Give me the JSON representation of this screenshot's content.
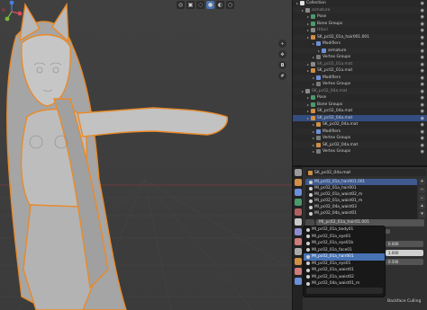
{
  "outliner": {
    "rows": [
      {
        "label": "Collection",
        "icon": "collection-icon",
        "depth": 0,
        "dim": false,
        "color": "#e0e0e0"
      },
      {
        "label": "armature",
        "icon": "armature-icon",
        "depth": 1,
        "dim": true,
        "color": "#8a8a8a"
      },
      {
        "label": "Pose",
        "icon": "pose-icon",
        "depth": 2,
        "dim": false,
        "color": "#4b9a6c"
      },
      {
        "label": "Bone Groups",
        "icon": "bone-group-icon",
        "depth": 2,
        "dim": false,
        "color": "#4b9a6c"
      },
      {
        "label": "Hitori",
        "icon": "armature-icon",
        "depth": 2,
        "dim": true,
        "color": "#8a8a8a"
      },
      {
        "label": "SK_pc02_01a_hair001.001",
        "icon": "mesh-icon",
        "depth": 2,
        "dim": false,
        "color": "#d08f45"
      },
      {
        "label": "Modifiers",
        "icon": "wrench-icon",
        "depth": 3,
        "dim": false,
        "color": "#6c8fd9"
      },
      {
        "label": "armature",
        "icon": "modifier-icon",
        "depth": 4,
        "dim": false,
        "color": "#6c8fd9"
      },
      {
        "label": "Vertex Groups",
        "icon": "vertex-group-icon",
        "depth": 3,
        "dim": false,
        "color": "#7a7a7a"
      },
      {
        "label": "SK_pc02_01a.mat",
        "icon": "mesh-icon",
        "depth": 2,
        "dim": true,
        "color": "#8a8a8a"
      },
      {
        "label": "SK_pc02_01a.mat",
        "icon": "mesh-icon",
        "depth": 2,
        "dim": false,
        "color": "#d08f45"
      },
      {
        "label": "Modifiers",
        "icon": "wrench-icon",
        "depth": 3,
        "dim": false,
        "color": "#6c8fd9"
      },
      {
        "label": "Vertex Groups",
        "icon": "vertex-group-icon",
        "depth": 3,
        "dim": false,
        "color": "#7a7a7a"
      },
      {
        "label": "SK_pc02_04a.mat",
        "icon": "armature-icon",
        "depth": 1,
        "dim": true,
        "color": "#8a8a8a"
      },
      {
        "label": "Pose",
        "icon": "pose-icon",
        "depth": 2,
        "dim": false,
        "color": "#4b9a6c"
      },
      {
        "label": "Bone Groups",
        "icon": "bone-group-icon",
        "depth": 2,
        "dim": false,
        "color": "#4b9a6c"
      },
      {
        "label": "SK_pc02_04a.mat",
        "icon": "mesh-icon",
        "depth": 2,
        "dim": false,
        "color": "#d08f45"
      },
      {
        "label": "SK_pc02_04a.mat",
        "icon": "mesh-icon",
        "depth": 2,
        "dim": false,
        "color": "#d08f45",
        "selected": true
      },
      {
        "label": "SK_pc02_04a.mat",
        "icon": "mesh-icon",
        "depth": 3,
        "dim": false,
        "color": "#d08f45"
      },
      {
        "label": "Modifiers",
        "icon": "wrench-icon",
        "depth": 3,
        "dim": false,
        "color": "#6c8fd9"
      },
      {
        "label": "Vertex Groups",
        "icon": "vertex-group-icon",
        "depth": 3,
        "dim": false,
        "color": "#7a7a7a"
      },
      {
        "label": "SK_pc02_04a.mat",
        "icon": "mesh-icon",
        "depth": 3,
        "dim": false,
        "color": "#d08f45"
      },
      {
        "label": "Vertex Groups",
        "icon": "vertex-group-icon",
        "depth": 3,
        "dim": false,
        "color": "#7a7a7a"
      }
    ]
  },
  "properties": {
    "object_name": "SK_pc02_04a.mat",
    "tab_colors": [
      "#9a9a9a",
      "#d08f45",
      "#6c8fd9",
      "#4b9a6c",
      "#b06060",
      "#c9c9c9",
      "#8c8cd0",
      "#d07a7a",
      "#aaaaaa",
      "#d08f45",
      "#d07a7a",
      "#6c8fd9"
    ],
    "material_slots": [
      {
        "label": "MI_pc02_01a_hair001.001",
        "selected": true
      },
      {
        "label": "MI_pc02_01a_hair001",
        "selected": false
      },
      {
        "label": "MI_pc02_01a_waist02_m",
        "selected": false
      },
      {
        "label": "MI_pc02_01a_waist01_m",
        "selected": false
      },
      {
        "label": "MI_pc02_04a_waist03",
        "selected": false
      },
      {
        "label": "MI_pc02_04a_waist01",
        "selected": false
      }
    ],
    "material_field": "MI_pc02_01a_hair01.001",
    "dropdown_items": [
      {
        "label": "MI_pc02_01a_body01",
        "highlighted": false
      },
      {
        "label": "MI_pc02_01a_eye01",
        "highlighted": false
      },
      {
        "label": "MI_pc02_01a_eye01b",
        "highlighted": false
      },
      {
        "label": "MI_pc02_01a_face01",
        "highlighted": false
      },
      {
        "label": "MI_pc02_01a_hair001",
        "highlighted": true
      },
      {
        "label": "MI_pc02_01a_eye01",
        "highlighted": false
      },
      {
        "label": "MI_pc02_01a_waist01",
        "highlighted": false
      },
      {
        "label": "MI_pc02_01a_waist02",
        "highlighted": false
      },
      {
        "label": "MI_pc02_04a_waist01_m",
        "highlighted": false
      },
      {
        "label": "MI_pc02_04a_waist03_m",
        "highlighted": false
      }
    ],
    "side_values": [
      "0.000",
      "1.000",
      "0.500"
    ],
    "backface_label": "Backface Culling"
  },
  "viewport": {
    "gizmo": {
      "x_color": "#e04a5a",
      "y_color": "#7bb53b",
      "z_color": "#4a7ee0"
    },
    "nav_icons": [
      "zoom-icon",
      "pan-icon",
      "camera-icon",
      "grid-icon"
    ],
    "toolbar_icons": [
      "overlay-icon",
      "xray-icon",
      "wireframe-shading-icon",
      "solid-shading-icon",
      "material-shading-icon",
      "rendered-shading-icon"
    ]
  }
}
